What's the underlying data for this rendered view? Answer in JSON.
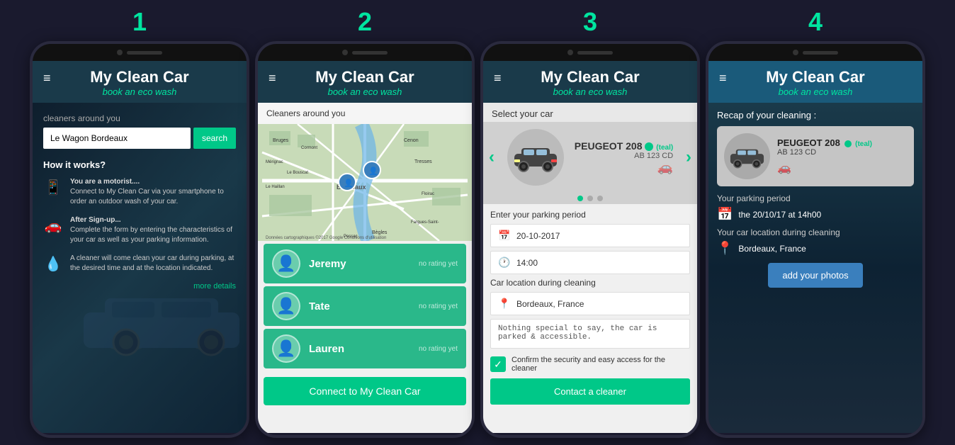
{
  "screens": [
    {
      "number": "1",
      "header": {
        "title": "My Clean Car",
        "subtitle": "book an eco wash",
        "menu_icon": "≡"
      },
      "content": {
        "cleaners_label": "cleaners around you",
        "search_placeholder": "Le Wagon Bordeaux",
        "search_button": "search",
        "how_it_works_title": "How it works?",
        "how_steps": [
          {
            "icon": "📱",
            "text_bold": "You are a motorist....",
            "text": "Connect to My Clean Car via your smartphone to order an outdoor wash of your car."
          },
          {
            "icon": "🚗",
            "text_bold": "After Sign-up...",
            "text": "Complete the form by entering the characteristics of your car as well as your parking information."
          },
          {
            "icon": "💧",
            "text_bold": "",
            "text": "A cleaner will come clean your car during parking, at the desired time and at the location indicated."
          }
        ],
        "more_details": "more details"
      }
    },
    {
      "number": "2",
      "header": {
        "title": "My Clean Car",
        "subtitle": "book an eco wash",
        "menu_icon": "≡"
      },
      "content": {
        "cleaners_around_label": "Cleaners around you",
        "cleaners": [
          {
            "name": "Jeremy",
            "rating": "no rating yet",
            "avatar": "👤"
          },
          {
            "name": "Tate",
            "rating": "no rating yet",
            "avatar": "👤"
          },
          {
            "name": "Lauren",
            "rating": "no rating yet",
            "avatar": "👤"
          }
        ],
        "connect_button": "Connect to My Clean Car"
      }
    },
    {
      "number": "3",
      "header": {
        "title": "My Clean Car",
        "subtitle": "book an eco wash",
        "menu_icon": "≡"
      },
      "content": {
        "select_car_label": "Select your car",
        "car_name": "PEUGEOT 208",
        "car_color": "(teal)",
        "car_plate": "AB 123 CD",
        "parking_period_label": "Enter your parking period",
        "date_value": "20-10-2017",
        "time_value": "14:00",
        "location_label": "Car location during cleaning",
        "location_value": "Bordeaux, France",
        "notes_value": "Nothing special to say, the car is parked & accessible.",
        "confirm_text": "Confirm the security and easy access for the cleaner",
        "contact_button": "Contact a cleaner"
      }
    },
    {
      "number": "4",
      "header": {
        "title": "My Clean Car",
        "subtitle": "book an eco wash",
        "menu_icon": "≡"
      },
      "content": {
        "recap_label": "Recap of your cleaning :",
        "car_name": "PEUGEOT 208",
        "car_color": "(teal)",
        "car_plate": "AB 123 CD",
        "parking_period_title": "Your parking period",
        "parking_period_value": "the 20/10/17 at 14h00",
        "location_title": "Your car location during cleaning",
        "location_value": "Bordeaux, France",
        "add_photos_button": "add your photos"
      }
    }
  ]
}
